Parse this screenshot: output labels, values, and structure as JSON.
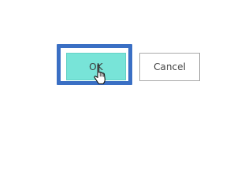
{
  "dialog": {
    "ok_label": "OK",
    "cancel_label": "Cancel"
  },
  "colors": {
    "ok_fill": "#78e4d8",
    "focus_ring": "#3a6fc4",
    "cancel_border": "#a9a9a9"
  },
  "cursor": {
    "icon": "hand-pointer-icon"
  }
}
